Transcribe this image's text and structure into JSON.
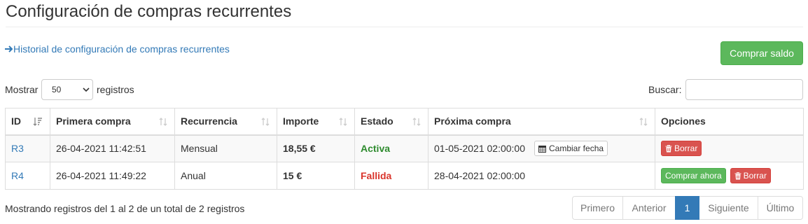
{
  "page": {
    "title": "Configuración de compras recurrentes",
    "history_link": "Historial de configuración de compras recurrentes",
    "buy_button": "Comprar saldo"
  },
  "controls": {
    "show_label": "Mostrar",
    "page_length": "50",
    "records_label": "registros",
    "search_label": "Buscar:",
    "search_value": ""
  },
  "table": {
    "columns": [
      "ID",
      "Primera compra",
      "Recurrencia",
      "Importe",
      "Estado",
      "Próxima compra",
      "Opciones"
    ],
    "rows": [
      {
        "id": "R3",
        "first_purchase": "26-04-2021 11:42:51",
        "recurrence": "Mensual",
        "amount": "18,55 €",
        "status": "Activa",
        "next_purchase": "01-05-2021 02:00:00",
        "change_date": "Cambiar fecha",
        "delete": "Borrar"
      },
      {
        "id": "R4",
        "first_purchase": "26-04-2021 11:49:22",
        "recurrence": "Anual",
        "amount": "15 €",
        "status": "Fallida",
        "next_purchase": "28-04-2021 02:00:00",
        "buy_now": "Comprar ahora",
        "delete": "Borrar"
      }
    ]
  },
  "footer": {
    "info": "Mostrando registros del 1 al 2 de un total de 2 registros",
    "pagination": {
      "first": "Primero",
      "previous": "Anterior",
      "current": "1",
      "next": "Siguiente",
      "last": "Último"
    }
  },
  "colors": {
    "link": "#337ab7",
    "success": "#5cb85c",
    "danger": "#d9534f",
    "status_active": "#2e8b2e",
    "status_failed": "#d9342b",
    "page_active": "#337ab7"
  },
  "icons": {
    "history_link": "arrow-right-icon",
    "sort": "sort-icon",
    "sort_active": "sort-amount-desc-icon",
    "change_date": "calendar-icon",
    "delete": "trash-icon",
    "page_length": "chevron-down-icon"
  }
}
